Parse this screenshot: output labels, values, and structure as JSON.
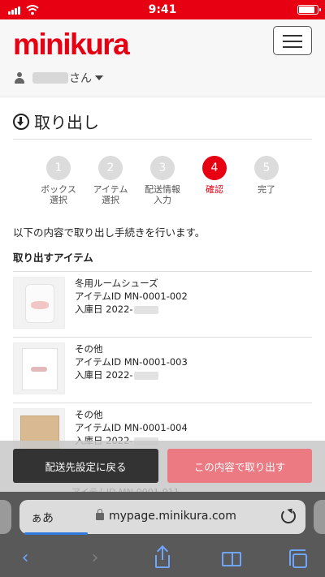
{
  "status_bar": {
    "time": "9:41"
  },
  "header": {
    "logo_text": "minikura",
    "user_suffix": "さん"
  },
  "page": {
    "title": "取り出し",
    "steps": [
      {
        "num": "1",
        "label": "ボックス\n選択",
        "active": false
      },
      {
        "num": "2",
        "label": "アイテム\n選択",
        "active": false
      },
      {
        "num": "3",
        "label": "配送情報\n入力",
        "active": false
      },
      {
        "num": "4",
        "label": "確認",
        "active": true
      },
      {
        "num": "5",
        "label": "完了",
        "active": false
      }
    ],
    "intro": "以下の内容で取り出し手続きを行います。",
    "section_title": "取り出すアイテム",
    "items": [
      {
        "name": "冬用ルームシューズ",
        "id_line": "アイテムID  MN-0001-002",
        "date_line": "入庫日  2022-"
      },
      {
        "name": "その他",
        "id_line": "アイテムID  MN-0001-003",
        "date_line": "入庫日  2022-"
      },
      {
        "name": "その他",
        "id_line": "アイテムID  MN-0001-004",
        "date_line": "入庫日  2022-"
      }
    ],
    "ghost_line": "アイテムID  MN-0001-011"
  },
  "actions": {
    "back_label": "配送先設定に戻る",
    "confirm_label": "この内容で取り出す"
  },
  "browser": {
    "aa_label": "ぁあ",
    "url": "mypage.minikura.com",
    "load_progress": 0.23,
    "back_symbol": "‹",
    "forward_symbol": "›"
  },
  "colors": {
    "brand": "#e60012",
    "confirm_button": "#eb7a82",
    "back_button": "#333333",
    "safari_link": "#6fa4ff"
  }
}
